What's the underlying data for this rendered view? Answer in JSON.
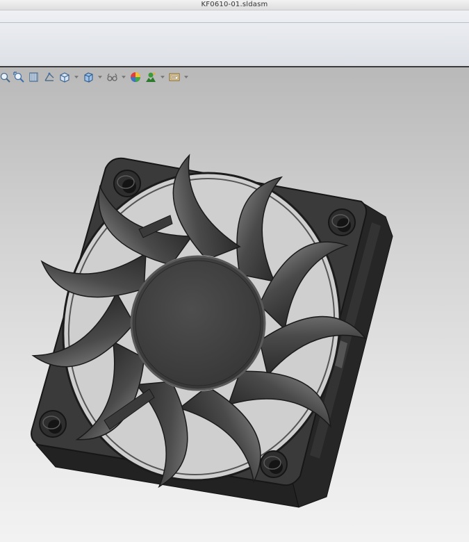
{
  "window": {
    "title": "KF0610-01.sldasm"
  },
  "heads_up_toolbar": {
    "tools": [
      {
        "icon": "zoom-to-fit-icon"
      },
      {
        "icon": "zoom-to-area-icon"
      },
      {
        "icon": "previous-view-icon"
      },
      {
        "icon": "section-view-icon"
      },
      {
        "icon": "view-orientation-icon",
        "has_dropdown": true
      },
      {
        "icon": "display-style-icon",
        "has_dropdown": true
      },
      {
        "icon": "hide-show-items-icon",
        "has_dropdown": true
      },
      {
        "icon": "edit-appearance-icon"
      },
      {
        "icon": "apply-scene-icon",
        "has_dropdown": true
      },
      {
        "icon": "view-settings-icon",
        "has_dropdown": true
      }
    ]
  },
  "model": {
    "name": "fan-model",
    "color": "#3a3a3a",
    "blade_count": 11
  }
}
